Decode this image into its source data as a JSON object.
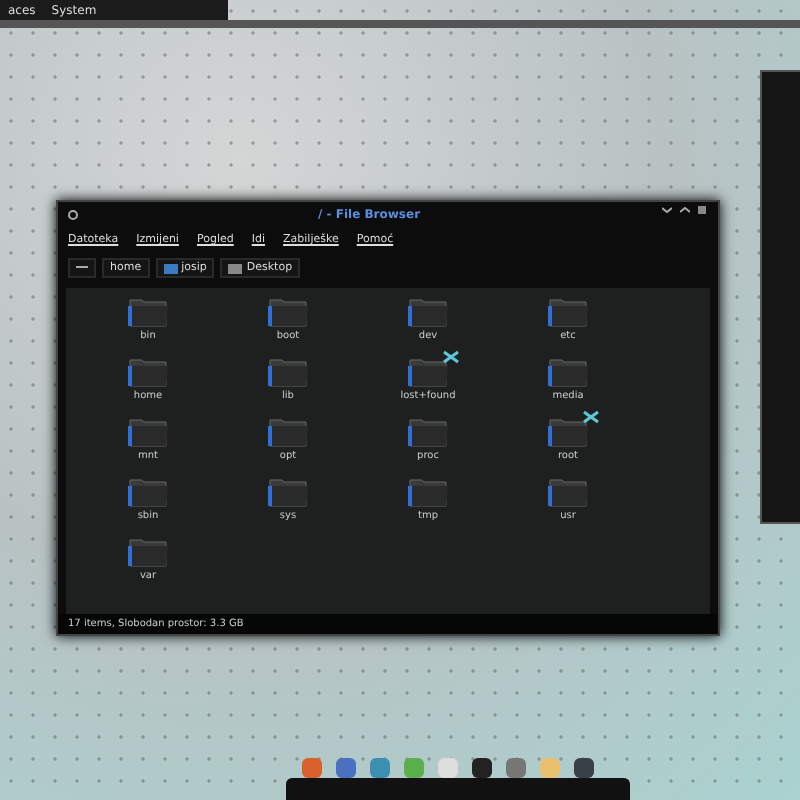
{
  "top_panel": {
    "menus": [
      "aces",
      "System"
    ]
  },
  "window": {
    "title": "/ - File Browser",
    "menu": [
      "Datoteka",
      "Izmijeni",
      "Pogled",
      "Idi",
      "Zabilješke",
      "Pomoć"
    ],
    "path": [
      {
        "label": "home",
        "kind": "plain"
      },
      {
        "label": "josip",
        "kind": "user"
      },
      {
        "label": "Desktop",
        "kind": "desktop"
      }
    ],
    "files": [
      {
        "name": "bin",
        "emblem": false
      },
      {
        "name": "boot",
        "emblem": false
      },
      {
        "name": "dev",
        "emblem": false
      },
      {
        "name": "etc",
        "emblem": false
      },
      {
        "name": "home",
        "emblem": false
      },
      {
        "name": "lib",
        "emblem": false
      },
      {
        "name": "lost+found",
        "emblem": true
      },
      {
        "name": "media",
        "emblem": false
      },
      {
        "name": "mnt",
        "emblem": false
      },
      {
        "name": "opt",
        "emblem": false
      },
      {
        "name": "proc",
        "emblem": false
      },
      {
        "name": "root",
        "emblem": true
      },
      {
        "name": "sbin",
        "emblem": false
      },
      {
        "name": "sys",
        "emblem": false
      },
      {
        "name": "tmp",
        "emblem": false
      },
      {
        "name": "usr",
        "emblem": false
      },
      {
        "name": "var",
        "emblem": false
      }
    ],
    "status": "17 items, Slobodan prostor: 3.3 GB"
  }
}
